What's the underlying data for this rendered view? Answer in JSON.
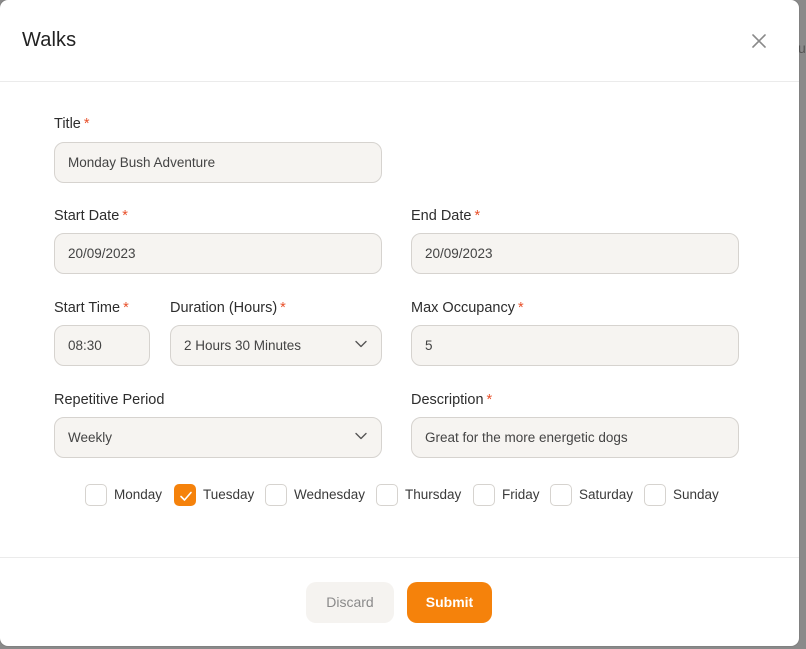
{
  "backdrop": {
    "partial_text": "u"
  },
  "modal": {
    "title": "Walks"
  },
  "fields": {
    "title": {
      "label": "Title",
      "required": "*",
      "value": "Monday Bush Adventure"
    },
    "start_date": {
      "label": "Start Date",
      "required": "*",
      "value": "20/09/2023"
    },
    "end_date": {
      "label": "End Date",
      "required": "*",
      "value": "20/09/2023"
    },
    "start_time": {
      "label": "Start Time",
      "required": "*",
      "value": "08:30"
    },
    "duration": {
      "label": "Duration (Hours)",
      "required": "*",
      "value": "2 Hours 30 Minutes"
    },
    "max_occupancy": {
      "label": "Max Occupancy",
      "required": "*",
      "value": "5"
    },
    "repetitive_period": {
      "label": "Repetitive Period",
      "value": "Weekly"
    },
    "description": {
      "label": "Description",
      "required": "*",
      "value": "Great for the more energetic dogs"
    }
  },
  "days": [
    {
      "label": "Monday",
      "checked": false
    },
    {
      "label": "Tuesday",
      "checked": true
    },
    {
      "label": "Wednesday",
      "checked": false
    },
    {
      "label": "Thursday",
      "checked": false
    },
    {
      "label": "Friday",
      "checked": false
    },
    {
      "label": "Saturday",
      "checked": false
    },
    {
      "label": "Sunday",
      "checked": false
    }
  ],
  "footer": {
    "discard_label": "Discard",
    "submit_label": "Submit"
  },
  "colors": {
    "accent": "#f5820b",
    "required": "#e8502a",
    "input_bg": "#f6f4f1"
  }
}
